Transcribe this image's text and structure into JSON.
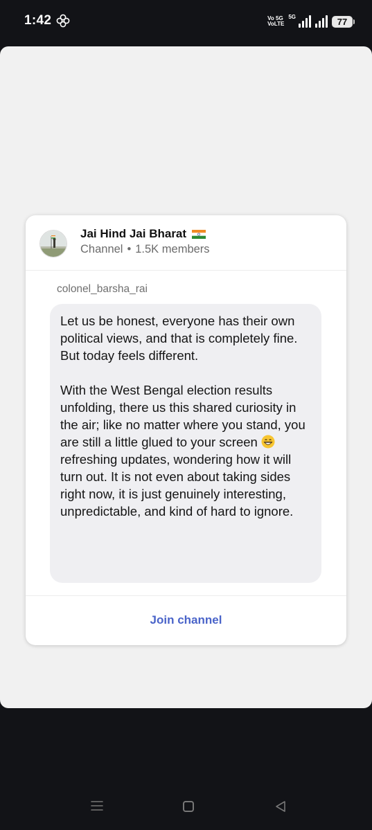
{
  "status_bar": {
    "time": "1:42",
    "net_line1": "Vo 5G",
    "net_line2": "VoLTE",
    "fiveg": "5G",
    "battery": "77"
  },
  "channel": {
    "name": "Jai Hind Jai Bharat",
    "type": "Channel",
    "separator": "•",
    "members": "1.5K members"
  },
  "message": {
    "sender": "colonel_barsha_rai",
    "paragraph1": "Let us be honest, everyone has their own political views, and that is completely fine. But today feels different.",
    "paragraph2_before_emoji": "With the West Bengal election results unfolding, there us this shared curiosity in the air; like no matter where you stand, you are still a little glued to your screen ",
    "paragraph2_after_emoji": " refreshing updates, wondering how it will turn out. It is not even about taking sides right now, it is just genuinely interesting, unpredictable, and kind of hard to ignore."
  },
  "footer": {
    "join_label": "Join channel"
  },
  "colors": {
    "accent": "#4a64c9",
    "bubble": "#efeff2",
    "sheet": "#f1f1f1",
    "background": "#121317"
  }
}
